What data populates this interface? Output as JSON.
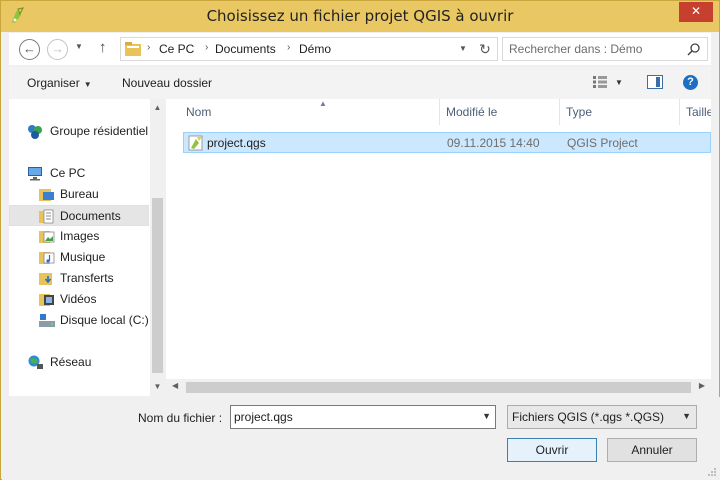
{
  "window": {
    "title": "Choisissez un fichier projet QGIS à ouvrir",
    "close": "✕"
  },
  "nav": {
    "breadcrumb": [
      "Ce PC",
      "Documents",
      "Démo"
    ],
    "search_placeholder": "Rechercher dans : Démo"
  },
  "toolbar": {
    "organize": "Organiser",
    "new_folder": "Nouveau dossier",
    "help": "?"
  },
  "sidebar": {
    "items": [
      {
        "label": "Groupe résidentiel",
        "icon": "homegroup-icon"
      },
      {
        "label": "Ce PC",
        "icon": "computer-icon"
      },
      {
        "label": "Bureau",
        "icon": "desktop-folder-icon"
      },
      {
        "label": "Documents",
        "icon": "documents-folder-icon",
        "selected": true
      },
      {
        "label": "Images",
        "icon": "pictures-folder-icon"
      },
      {
        "label": "Musique",
        "icon": "music-folder-icon"
      },
      {
        "label": "Transferts",
        "icon": "downloads-folder-icon"
      },
      {
        "label": "Vidéos",
        "icon": "videos-folder-icon"
      },
      {
        "label": "Disque local (C:)",
        "icon": "drive-icon"
      },
      {
        "label": "Réseau",
        "icon": "network-icon"
      }
    ]
  },
  "columns": [
    "Nom",
    "Modifié le",
    "Type",
    "Taille"
  ],
  "files": [
    {
      "name": "project.qgs",
      "modified": "09.11.2015 14:40",
      "type": "QGIS Project",
      "selected": true
    }
  ],
  "footer": {
    "filename_label": "Nom du fichier :",
    "filename_value": "project.qgs",
    "filter": "Fichiers QGIS (*.qgs *.QGS)",
    "open": "Ouvrir",
    "cancel": "Annuler"
  },
  "colors": {
    "titlebar": "#e9c762",
    "selection": "#cce8ff",
    "close": "#c7402f"
  }
}
